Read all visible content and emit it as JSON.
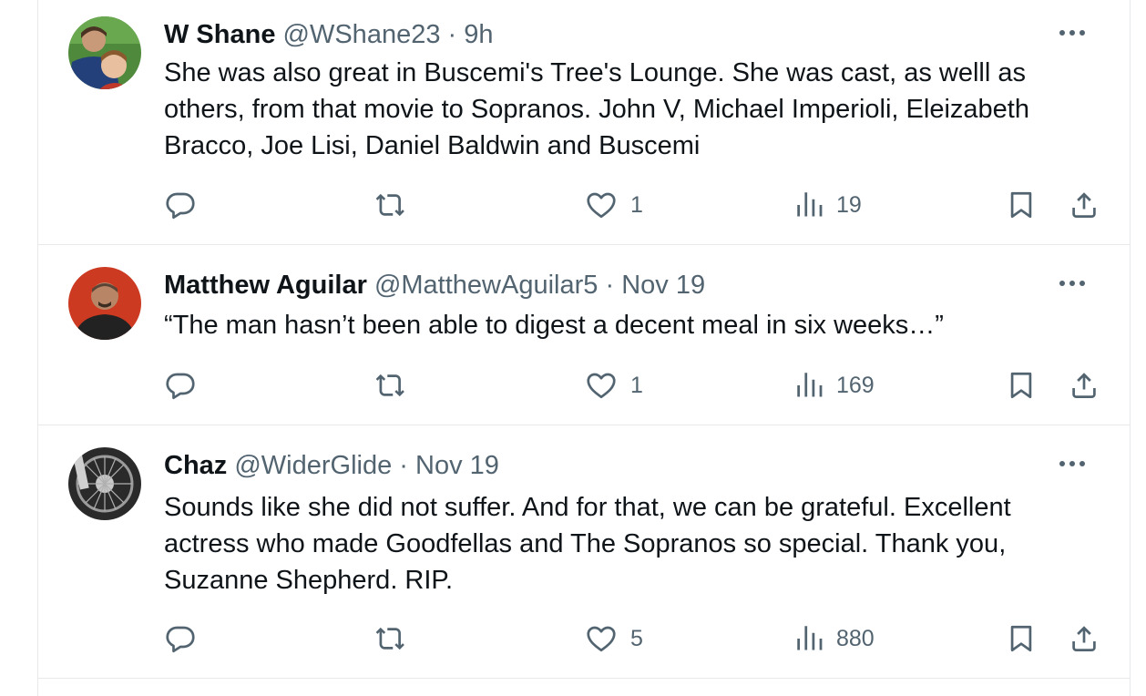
{
  "colors": {
    "text_primary": "#0f1419",
    "text_secondary": "#536471",
    "divider": "#e7e9ea"
  },
  "icons": {
    "reply": "speech-bubble-icon",
    "retweet": "retweet-arrows-icon",
    "like": "heart-icon",
    "views": "bar-chart-icon",
    "bookmark": "bookmark-icon",
    "share": "upload-share-icon",
    "more": "ellipsis-icon"
  },
  "tweets": [
    {
      "name": "W Shane",
      "handle": "@WShane23",
      "separator": "·",
      "time": "9h",
      "text": "She was also great in Buscemi's Tree's Lounge. She was cast, as welll as others, from that movie to Sopranos. John V, Michael Imperioli, Eleizabeth Bracco, Joe Lisi, Daniel Baldwin and Buscemi",
      "replies": "",
      "retweets": "",
      "likes": "1",
      "views": "19"
    },
    {
      "name": "Matthew Aguilar",
      "handle": "@MatthewAguilar5",
      "separator": "·",
      "time": "Nov 19",
      "text": "“The man hasn’t been able to digest a decent meal in six weeks…”",
      "replies": "",
      "retweets": "",
      "likes": "1",
      "views": "169"
    },
    {
      "name": "Chaz",
      "handle": "@WiderGlide",
      "separator": "·",
      "time": "Nov 19",
      "text": "Sounds like she did not suffer.  And for that, we can be grateful.  Excellent actress who made Goodfellas and The Sopranos so special.  Thank you, Suzanne Shepherd.  RIP.",
      "replies": "",
      "retweets": "",
      "likes": "5",
      "views": "880"
    }
  ]
}
